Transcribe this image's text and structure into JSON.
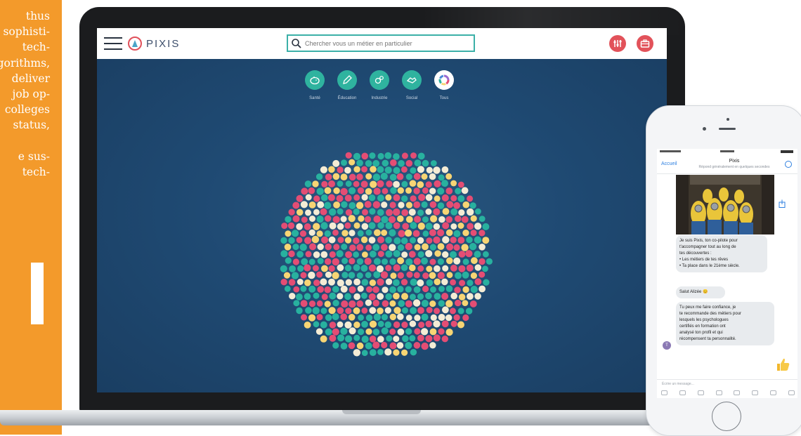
{
  "side_panel": {
    "lines": [
      "thus",
      "sophisti-",
      "tech-",
      "algorithms,",
      "deliver",
      "job op-",
      "colleges",
      "status,",
      "",
      "e sus-",
      "tech-"
    ]
  },
  "app": {
    "logo_text": "PIXIS",
    "search": {
      "placeholder": "Chercher vous un métier en particulier"
    },
    "header_buttons": [
      "settings-icon",
      "briefcase-icon"
    ],
    "categories": [
      {
        "label": "Santé",
        "icon": "piggy-bank-icon"
      },
      {
        "label": "Éducation",
        "icon": "pencil-icon"
      },
      {
        "label": "Industrie",
        "icon": "gears-icon"
      },
      {
        "label": "Social",
        "icon": "handshake-icon"
      },
      {
        "label": "Tous",
        "icon": "color-wheel-icon"
      }
    ],
    "colors": {
      "accent_teal": "#2fb39f",
      "red": "#e2525a",
      "bubble_pink": "#e44d74",
      "bubble_yellow": "#f7d574",
      "bubble_teal": "#28b19f",
      "bubble_cream": "#f4ecd5",
      "background": "#1f4a73"
    }
  },
  "phone": {
    "back_label": "Accueil",
    "chat_title": "Pixis",
    "chat_subtitle": "Répond généralement en quelques secondes",
    "messages": [
      {
        "lines": [
          "Je suis Pixis, ton co-pilote pour",
          "t'accompagner tout au long de",
          "tes découvertes :",
          "• Les métiers de tes rêves",
          "• Ta place dans le 21ème siècle."
        ]
      },
      {
        "lines": [
          "Salut Alizée 😊"
        ]
      },
      {
        "lines": [
          "Tu peux me faire confiance, je",
          "te recommande des métiers pour",
          "lesquels les psychologues",
          "certifiés en formation ont",
          "analysé ton profil et qui",
          "récompensent ta personnalité."
        ]
      }
    ],
    "avatar_letter": "T",
    "composer_placeholder": "Écrire un message..."
  }
}
